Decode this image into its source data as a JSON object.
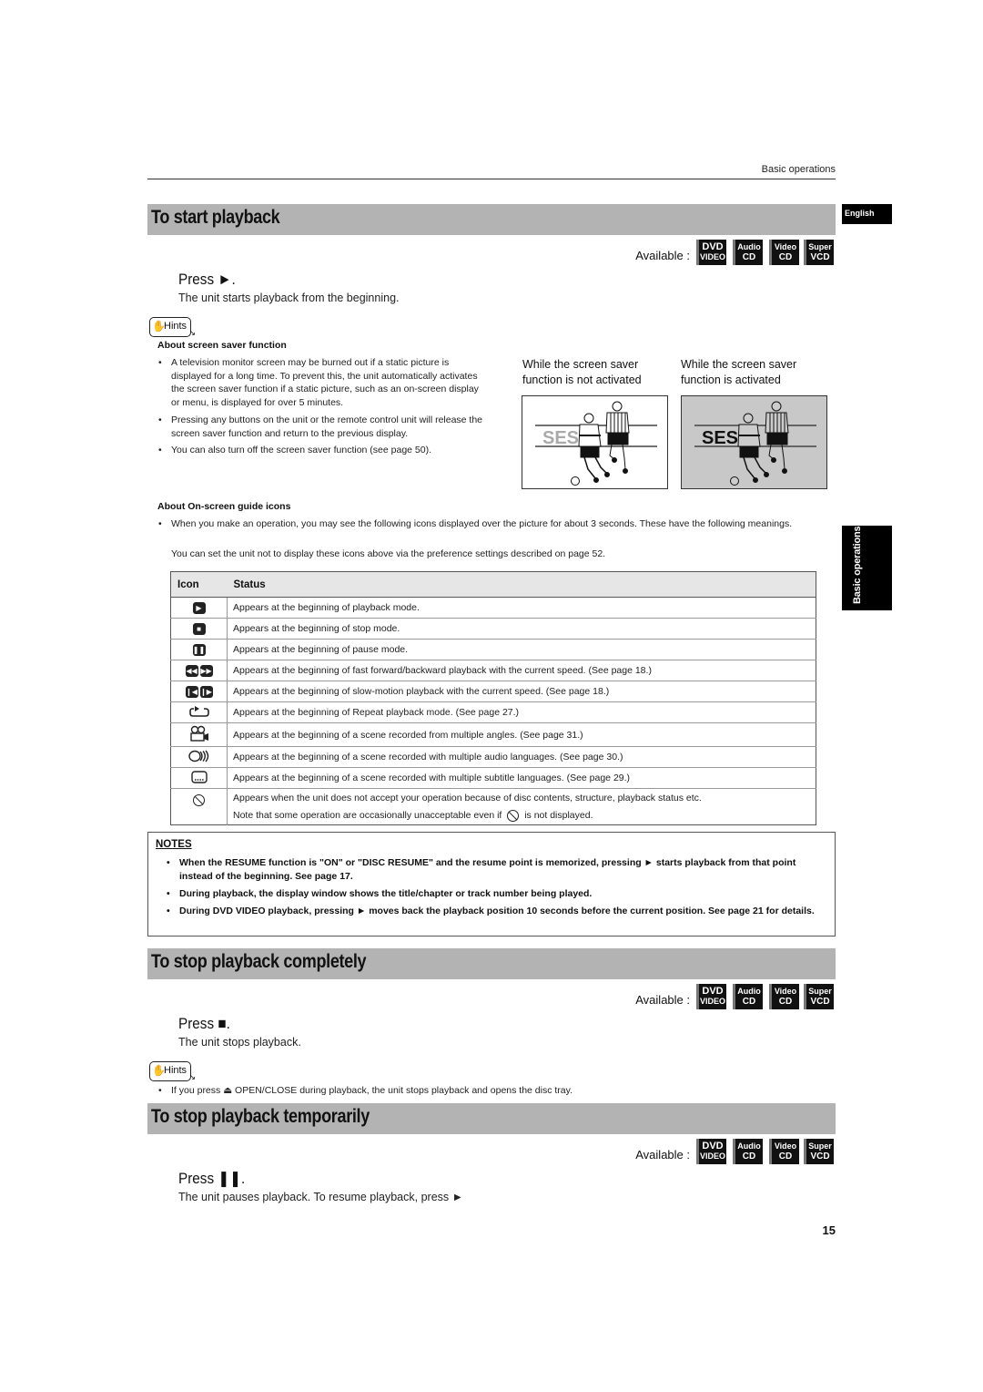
{
  "header": {
    "running_head": "Basic operations"
  },
  "side_tabs": {
    "language": "English",
    "chapter": "Basic operations"
  },
  "availability": {
    "label": "Available :",
    "badges": [
      {
        "top": "DVD",
        "bottom": "VIDEO",
        "icon": "dvd-video-badge"
      },
      {
        "top": "Audio",
        "bottom": "CD",
        "icon": "audio-cd-badge"
      },
      {
        "top": "Video",
        "bottom": "CD",
        "icon": "video-cd-badge"
      },
      {
        "top": "Super",
        "bottom": "VCD",
        "icon": "super-vcd-badge"
      }
    ]
  },
  "sections": [
    {
      "title": "To start playback",
      "press": "Press ►.",
      "description": "The unit starts playback from the beginning."
    },
    {
      "title": "To stop playback completely",
      "press": "Press ■.",
      "description": "The unit stops playback."
    },
    {
      "title": "To stop playback temporarily",
      "press": "Press ❚❚.",
      "description": "The unit pauses playback. To resume playback, press ►"
    }
  ],
  "hints_label": "Hints",
  "screen_saver": {
    "heading": "About screen saver function",
    "bullets": [
      "A television monitor screen may be burned out if a static picture is displayed for a long time. To prevent this, the unit automatically activates the screen saver function if a static picture, such as an on-screen display or menu, is displayed for over 5 minutes.",
      "Pressing any buttons on the unit or the remote control unit will release the screen saver function and return to the previous display.",
      "You can also turn off the screen saver function (see page 50)."
    ],
    "captions": [
      "While the screen saver function is not activated",
      "While the screen saver function is activated"
    ],
    "illustration_text": "SES"
  },
  "guide_icons": {
    "heading": "About On-screen guide icons",
    "bullet": "When you make an operation, you may see the following icons displayed over the picture for about 3 seconds. These have the following meanings.",
    "note": "You can set the unit not to display these icons above via the preference settings described on page 52.",
    "columns": [
      "Icon",
      "Status"
    ],
    "rows": [
      {
        "icon": "play-icon",
        "status": "Appears at the beginning of playback mode."
      },
      {
        "icon": "stop-icon",
        "status": "Appears at the beginning of stop mode."
      },
      {
        "icon": "pause-icon",
        "status": "Appears at the beginning of pause mode."
      },
      {
        "icon": "fast-forward-backward-icon",
        "status": "Appears at the beginning of fast forward/backward playback with the current speed. (See page 18.)"
      },
      {
        "icon": "slow-motion-icon",
        "status": "Appears at the beginning of slow-motion playback with the current speed. (See page 18.)"
      },
      {
        "icon": "repeat-icon",
        "status": "Appears at the beginning of Repeat playback mode. (See page 27.)"
      },
      {
        "icon": "angle-camera-icon",
        "status": "Appears at the beginning of a scene recorded from multiple angles. (See page 31.)"
      },
      {
        "icon": "audio-language-icon",
        "status": "Appears at the beginning of a scene recorded with multiple audio languages. (See page 30.)"
      },
      {
        "icon": "subtitle-icon",
        "status": "Appears at the beginning of a scene recorded with multiple subtitle languages. (See page 29.)"
      },
      {
        "icon": "prohibited-icon",
        "status": "Appears when the unit does not accept your operation because of disc contents, structure, playback status etc.",
        "status_line2_before": "Note that some operation are occasionally unacceptable even if",
        "status_line2_after": "is not displayed."
      }
    ]
  },
  "notes": {
    "title": "NOTES",
    "items": [
      "When the RESUME function is \"ON\" or \"DISC RESUME\" and the resume point is memorized, pressing ► starts playback from that point instead of the beginning. See page 17.",
      "During playback, the display window shows the title/chapter or track number being played.",
      "During DVD VIDEO playback, pressing ► moves back the playback position 10 seconds before the current position. See page 21 for details."
    ]
  },
  "stop_hint": "If you press ⏏ OPEN/CLOSE during playback, the unit stops playback and opens the disc tray.",
  "page_number": "15"
}
